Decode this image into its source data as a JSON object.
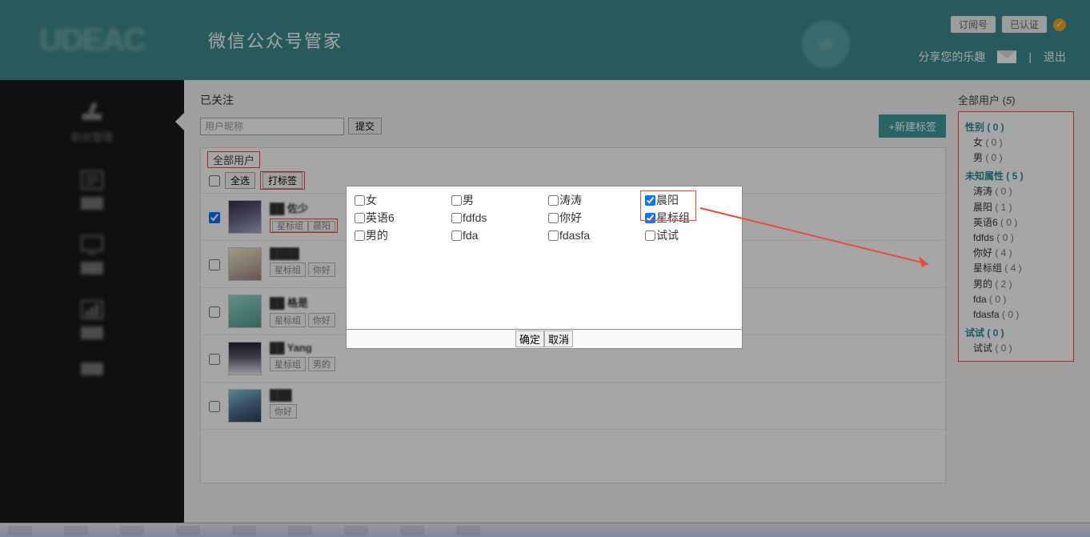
{
  "header": {
    "logo": "UDEAC",
    "title": "微信公众号管家",
    "badges": {
      "sub": "订阅号",
      "auth": "已认证"
    },
    "share": "分享您的乐趣",
    "logout": "退出"
  },
  "sidebar": {
    "items": [
      {
        "label": "粉丝管理"
      },
      {
        "label": ""
      },
      {
        "label": ""
      },
      {
        "label": ""
      },
      {
        "label": ""
      }
    ]
  },
  "tab": "已关注",
  "search": {
    "placeholder": "用户昵称",
    "submit": "提交"
  },
  "new_tag_btn": "+新建标签",
  "list": {
    "section": "全部用户",
    "select_all": "全选",
    "tag_btn": "打标签",
    "users": [
      {
        "name": "██ 佐少",
        "tags": [
          "星标组",
          "晨阳"
        ],
        "checked": true,
        "av": "ua1"
      },
      {
        "name": "████",
        "tags": [
          "星标组",
          "你好"
        ],
        "checked": false,
        "av": "ua2"
      },
      {
        "name": "██ 格是",
        "tags": [
          "星标组",
          "你好"
        ],
        "checked": false,
        "av": "ua3"
      },
      {
        "name": "██ Yang",
        "tags": [
          "星标组",
          "男的"
        ],
        "checked": false,
        "av": "ua4"
      },
      {
        "name": "███",
        "tags": [
          "你好"
        ],
        "checked": false,
        "av": "ua5"
      }
    ]
  },
  "right": {
    "title": "全部用户",
    "count": "5",
    "groups": [
      {
        "title": "性别",
        "count": "0",
        "items": [
          {
            "label": "女",
            "n": "0"
          },
          {
            "label": "男",
            "n": "0"
          }
        ]
      },
      {
        "title": "未知属性",
        "count": "5",
        "items": [
          {
            "label": "涛涛",
            "n": "0"
          },
          {
            "label": "晨阳",
            "n": "1"
          },
          {
            "label": "英语6",
            "n": "0"
          },
          {
            "label": "fdfds",
            "n": "0"
          },
          {
            "label": "你好",
            "n": "4"
          },
          {
            "label": "星标组",
            "n": "4"
          },
          {
            "label": "男的",
            "n": "2"
          },
          {
            "label": "fda",
            "n": "0"
          },
          {
            "label": "fdasfa",
            "n": "0"
          }
        ]
      },
      {
        "title": "试试",
        "count": "0",
        "items": [
          {
            "label": "试试",
            "n": "0"
          }
        ]
      }
    ]
  },
  "modal": {
    "options": [
      {
        "label": "女",
        "checked": false
      },
      {
        "label": "男",
        "checked": false
      },
      {
        "label": "涛涛",
        "checked": false
      },
      {
        "label": "晨阳",
        "checked": true
      },
      {
        "label": "英语6",
        "checked": false
      },
      {
        "label": "fdfds",
        "checked": false
      },
      {
        "label": "你好",
        "checked": false
      },
      {
        "label": "星标组",
        "checked": true
      },
      {
        "label": "男的",
        "checked": false
      },
      {
        "label": "fda",
        "checked": false
      },
      {
        "label": "fdasfa",
        "checked": false
      },
      {
        "label": "试试",
        "checked": false
      }
    ],
    "ok": "确定",
    "cancel": "取消"
  }
}
